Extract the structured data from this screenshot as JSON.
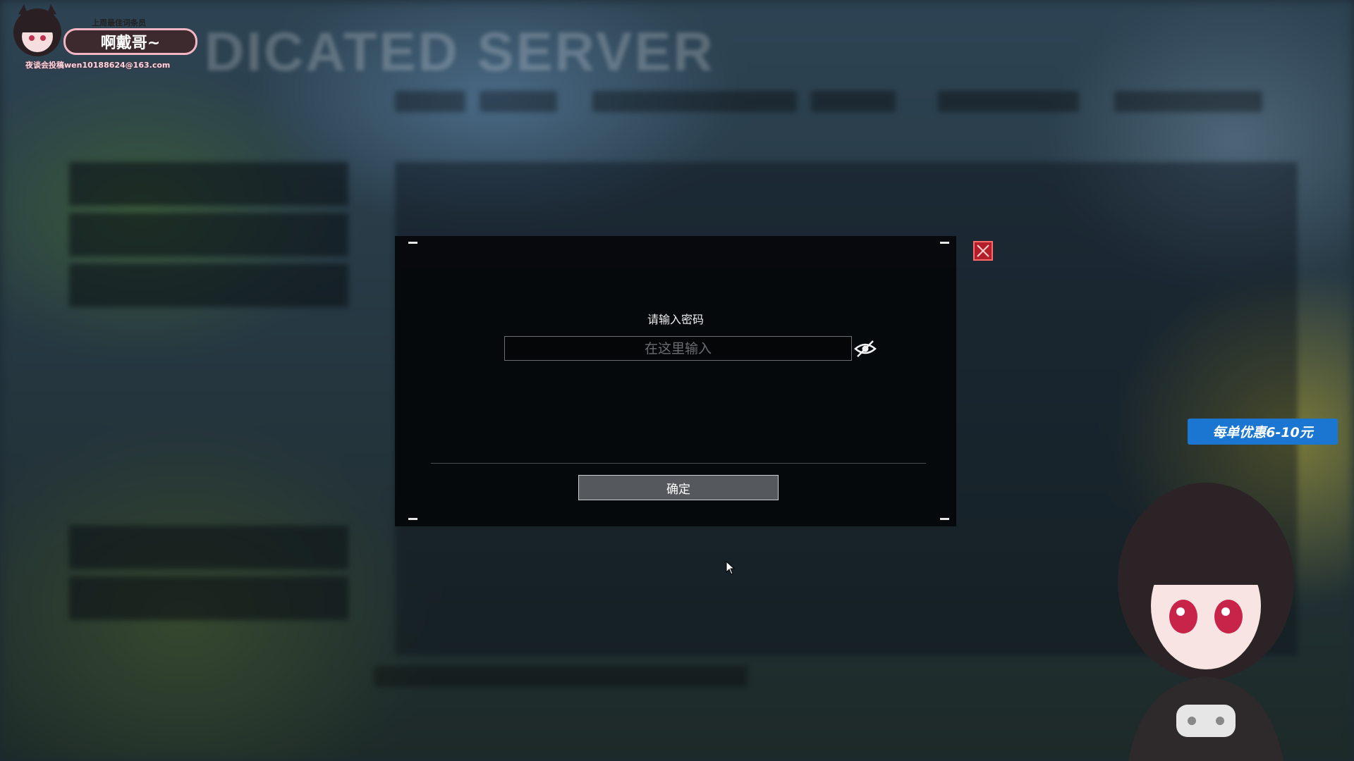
{
  "background": {
    "title": "DICATED SERVER"
  },
  "modal": {
    "title": "请输入密码",
    "password_placeholder": "在这里输入",
    "confirm_label": "确定"
  },
  "overlay": {
    "header_small": "上周最佳词条员",
    "streamer_name": "啊戴哥~",
    "contact": "夜谈会投稿wen10188624@163.com",
    "promo": "每单优惠6-10元"
  },
  "colors": {
    "close_red": "#b11f2a",
    "promo_blue": "#1a76d0",
    "confirm_bg": "#55595e"
  },
  "icons": [
    "close-icon",
    "eye-slash-icon",
    "mouse-cursor-icon"
  ]
}
